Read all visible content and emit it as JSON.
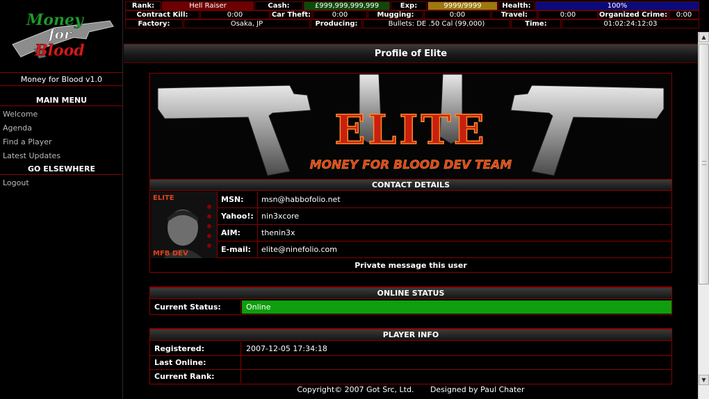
{
  "sidebar": {
    "logo_text": [
      "Money",
      "for",
      "Blood"
    ],
    "version": "Money for Blood v1.0",
    "main_menu_title": "MAIN MENU",
    "main_menu": [
      "Welcome",
      "Agenda",
      "Find a Player",
      "Latest Updates"
    ],
    "elsewhere_title": "GO ELSEWHERE",
    "elsewhere": [
      "Logout"
    ]
  },
  "stats": {
    "rank_label": "Rank:",
    "rank": "Hell Raiser",
    "cash_label": "Cash:",
    "cash": "£999,999,999,999",
    "exp_label": "Exp:",
    "exp": "9999/9999",
    "health_label": "Health:",
    "health": "100%",
    "contract_kill_label": "Contract Kill:",
    "contract_kill": "0:00",
    "car_theft_label": "Car Theft:",
    "car_theft": "0:00",
    "mugging_label": "Mugging:",
    "mugging": "0:00",
    "travel_label": "Travel:",
    "travel": "0:00",
    "organized_crime_label": "Organized Crime:",
    "organized_crime": "0:00",
    "factory_label": "Factory:",
    "factory": "Osaka, JP",
    "producing_label": "Producing:",
    "producing": "Bullets: DE .50 Cal (99,000)",
    "time_label": "Time:",
    "time": "01:02:24:12:03"
  },
  "profile": {
    "title": "Profile of Elite",
    "banner_title": "ELITE",
    "banner_subtitle": "MONEY FOR BLOOD DEV TEAM",
    "avatar_top": "ELITE",
    "avatar_bottom": "MFB DEV",
    "contact_title": "CONTACT DETAILS",
    "contacts": [
      {
        "label": "MSN:",
        "value": "msn@habbofolio.net"
      },
      {
        "label": "Yahoo!:",
        "value": "nin3xcore"
      },
      {
        "label": "AIM:",
        "value": "thenin3x"
      },
      {
        "label": "E-mail:",
        "value": "elite@ninefolio.com"
      }
    ],
    "pm_link": "Private message this user",
    "online_title": "ONLINE STATUS",
    "status_label": "Current Status:",
    "status_value": "Online",
    "player_info_title": "PLAYER INFO",
    "player_info": [
      {
        "label": "Registered:",
        "value": "2007-12-05 17:34:18"
      },
      {
        "label": "Last Online:",
        "value": ""
      },
      {
        "label": "Current Rank:",
        "value": ""
      }
    ]
  },
  "footer": {
    "copyright": "Copyright© 2007 Got Src, Ltd.",
    "designer": "Designed by Paul Chater"
  },
  "colors": {
    "accent_red": "#8b0000",
    "online_green": "#0d9f0d",
    "cash_green": "#0b4a0b",
    "exp_gold": "#9c7a0e",
    "health_blue": "#0a0a7a"
  }
}
